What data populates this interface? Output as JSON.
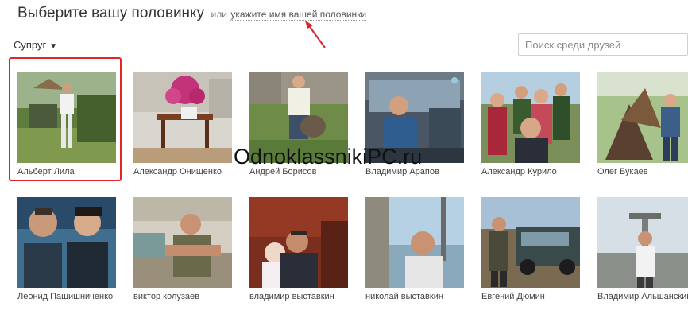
{
  "header": {
    "title": "Выберите вашу половинку",
    "or_text": "или",
    "link_text": "укажите имя вашей половинки"
  },
  "filter": {
    "label": "Супруг",
    "caret": "▼"
  },
  "search": {
    "placeholder": "Поиск среди друзей",
    "value": ""
  },
  "watermark": "OdnoklassnikiPC.ru",
  "colors": {
    "selection": "#e0262b",
    "arrow": "#d8262b"
  },
  "friends": [
    {
      "name": "Альберт Лила",
      "selected": true
    },
    {
      "name": "Александр Онищенко"
    },
    {
      "name": "Андрей Борисов"
    },
    {
      "name": "Владимир Арапов"
    },
    {
      "name": "Александр Курило"
    },
    {
      "name": "Олег Букаев"
    },
    {
      "name": "Леонид Пашишниченко"
    },
    {
      "name": "виктор колузаев"
    },
    {
      "name": "владимир выставкин"
    },
    {
      "name": "николай выставкин"
    },
    {
      "name": "Евгений Дюмин"
    },
    {
      "name": "Владимир Альшанский"
    }
  ]
}
